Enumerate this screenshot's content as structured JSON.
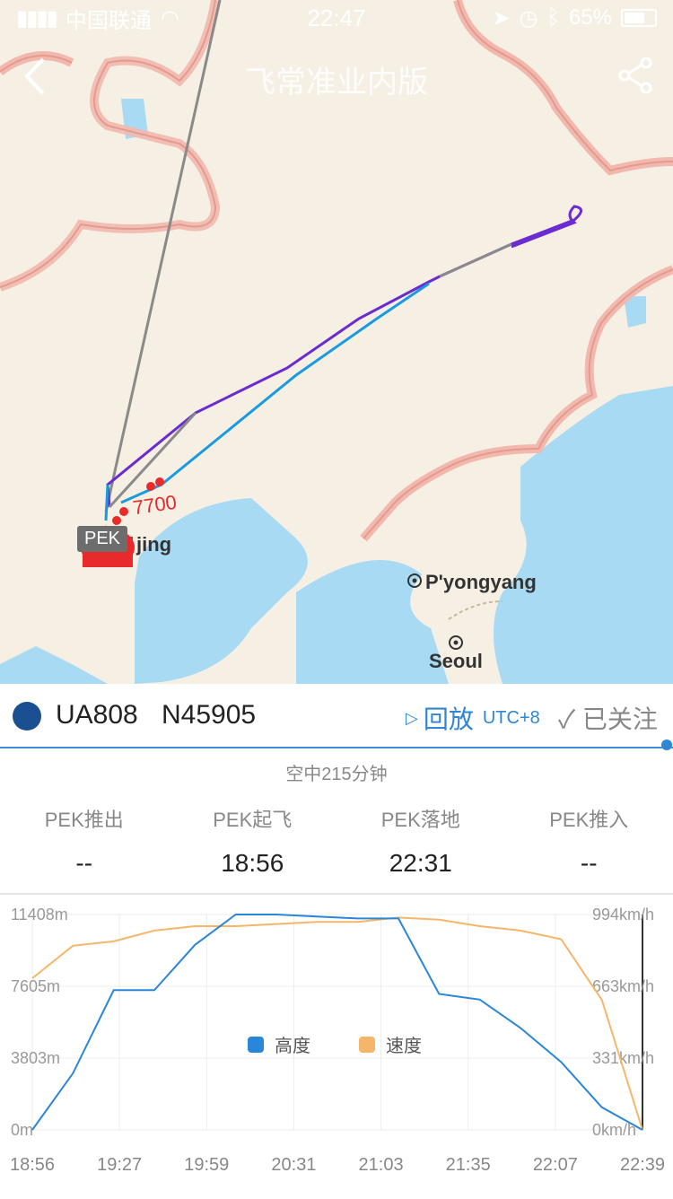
{
  "status": {
    "carrier": "中国联通",
    "time": "22:47",
    "battery": "65%"
  },
  "nav": {
    "title": "飞常准业内版"
  },
  "map": {
    "labels": {
      "beijing": "jing",
      "pyongyang": "P'yongyang",
      "seoul": "Seoul",
      "squawk": "7700"
    },
    "pek_badge": "PEK"
  },
  "flight": {
    "number": "UA808",
    "registration": "N45905",
    "replay_label": "回放",
    "utc": "UTC+8",
    "followed": "已关注",
    "airtime": "空中215分钟"
  },
  "times": [
    {
      "label": "PEK推出",
      "value": "--"
    },
    {
      "label": "PEK起飞",
      "value": "18:56"
    },
    {
      "label": "PEK落地",
      "value": "22:31"
    },
    {
      "label": "PEK推入",
      "value": "--"
    }
  ],
  "colors": {
    "altitude": "#2a86d9",
    "speed": "#f5b66a",
    "track_purple": "#6a2bd0",
    "track_blue": "#1a9ae0"
  },
  "chart_data": {
    "type": "line",
    "x": [
      "18:56",
      "19:27",
      "19:59",
      "20:31",
      "21:03",
      "21:35",
      "22:07",
      "22:39"
    ],
    "left_axis": [
      "11408m",
      "7605m",
      "3803m",
      "0m"
    ],
    "right_axis": [
      "994km/h",
      "663km/h",
      "331km/h",
      "0km/h"
    ],
    "legend": [
      "高度",
      "速度"
    ],
    "series": [
      {
        "name": "高度",
        "values": [
          0,
          3000,
          7400,
          7400,
          9800,
          11408,
          11408,
          11300,
          11200,
          11200,
          7200,
          6900,
          5400,
          3600,
          1200,
          0
        ]
      },
      {
        "name": "速度",
        "values": [
          700,
          850,
          870,
          920,
          940,
          940,
          950,
          960,
          960,
          980,
          970,
          940,
          920,
          880,
          600,
          0
        ]
      }
    ]
  }
}
